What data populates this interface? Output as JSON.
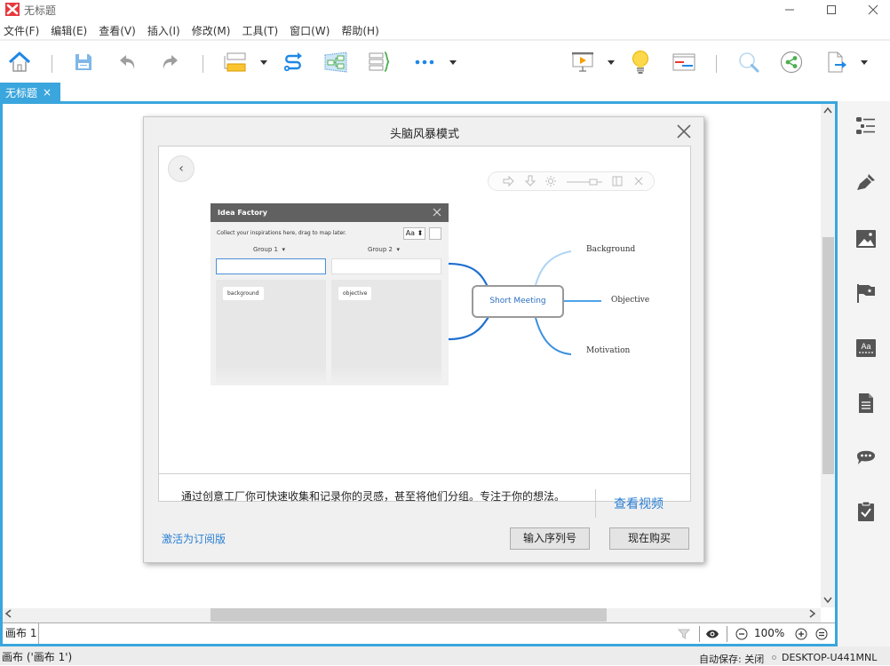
{
  "window": {
    "title": "无标题",
    "minimize_icon": "minimize-icon",
    "maximize_icon": "maximize-icon",
    "close_icon": "close-icon"
  },
  "menubar": {
    "items": [
      "文件(F)",
      "编辑(E)",
      "查看(V)",
      "插入(I)",
      "修改(M)",
      "工具(T)",
      "窗口(W)",
      "帮助(H)"
    ]
  },
  "toolbar": {
    "buttons": [
      {
        "name": "home",
        "icon": "home-icon"
      },
      {
        "name": "save",
        "icon": "save-icon"
      },
      {
        "name": "undo",
        "icon": "undo-icon"
      },
      {
        "name": "redo",
        "icon": "redo-icon"
      },
      {
        "name": "insert-topic",
        "icon": "topic-icon"
      },
      {
        "name": "relationship",
        "icon": "relationship-icon"
      },
      {
        "name": "boundary",
        "icon": "boundary-icon"
      },
      {
        "name": "summary",
        "icon": "summary-icon"
      },
      {
        "name": "more",
        "icon": "more-icon"
      },
      {
        "name": "presentation",
        "icon": "presentation-icon"
      },
      {
        "name": "brainstorm",
        "icon": "lightbulb-icon"
      },
      {
        "name": "gantt",
        "icon": "gantt-icon"
      },
      {
        "name": "search",
        "icon": "search-icon"
      },
      {
        "name": "share",
        "icon": "share-icon"
      },
      {
        "name": "export",
        "icon": "export-icon"
      }
    ]
  },
  "tabs": [
    {
      "label": "无标题",
      "close": "×"
    }
  ],
  "right_panel": {
    "icons": [
      "outline-icon",
      "format-brush-icon",
      "image-icon",
      "marker-flag-icon",
      "font-style-icon",
      "notes-icon",
      "comment-icon",
      "task-icon"
    ]
  },
  "dialog": {
    "title": "头脑风暴模式",
    "back_label": "‹",
    "preview": {
      "idea_factory": {
        "title": "Idea Factory",
        "hint": "Collect your inspirations here, drag to map later.",
        "font_button": "Aa ⬍",
        "groups": [
          {
            "label": "Group 1",
            "cards": [
              "background"
            ]
          },
          {
            "label": "Group 2",
            "cards": [
              "objective"
            ]
          }
        ]
      },
      "mindmap": {
        "central": "Short Meeting",
        "branches": [
          "Background",
          "Objective",
          "Motivation"
        ]
      }
    },
    "description": "通过创意工厂你可快速收集和记录你的灵感，甚至将他们分组。专注于你的想法。",
    "watch_video": "查看视频",
    "activate_link": "激活为订阅版",
    "enter_serial": "输入序列号",
    "buy_now": "现在购买"
  },
  "sheetbar": {
    "sheet_name": "画布 1",
    "zoom": "100%"
  },
  "statusbar": {
    "left": "画布 ('画布 1')",
    "autosave": "自动保存: 关闭",
    "host": "DESKTOP-U441MNL"
  },
  "colors": {
    "accent": "#3aa6dd",
    "link": "#2a7fd4",
    "logo": "#e8383d"
  }
}
